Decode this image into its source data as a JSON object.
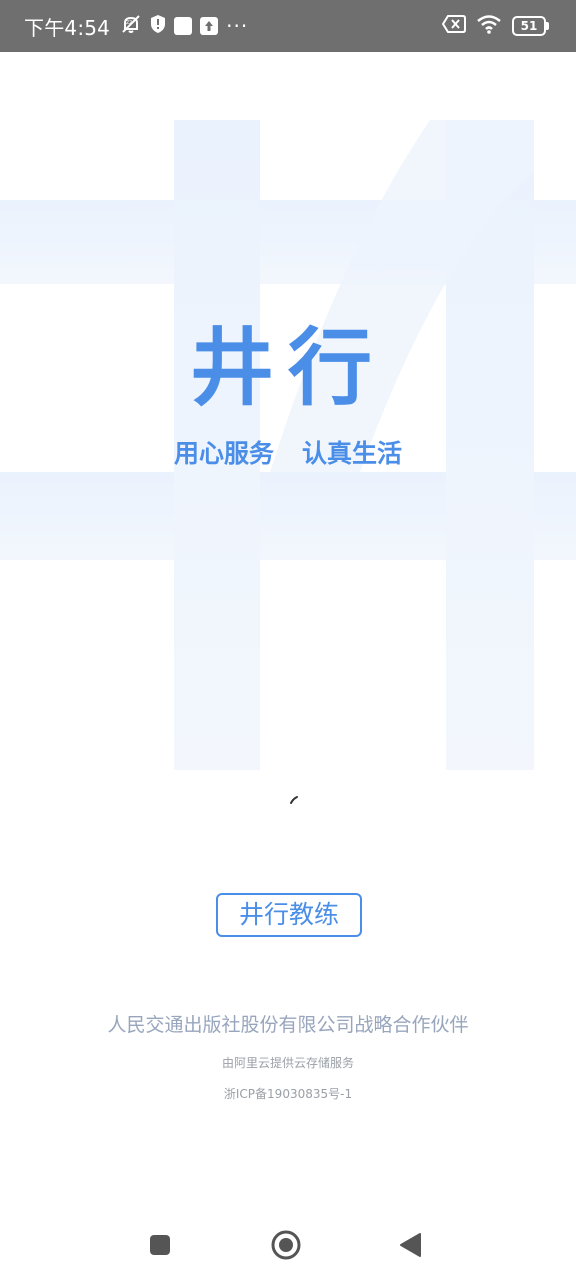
{
  "status_bar": {
    "time": "下午4:54",
    "battery_level": "51"
  },
  "logo": {
    "title": "井行"
  },
  "slogan": {
    "part1": "用心服务",
    "part2": "认真生活"
  },
  "coach_button": {
    "label": "井行教练"
  },
  "footer": {
    "partner": "人民交通出版社股份有限公司战略合作伙伴",
    "storage": "由阿里云提供云存储服务",
    "icp": "浙ICP备19030835号-1"
  },
  "icons": {
    "status_left": [
      "muted-bell-icon",
      "shield-icon",
      "square-notification-icon",
      "upload-icon",
      "more-icon"
    ],
    "status_right": [
      "sim-x-icon",
      "wifi-icon",
      "battery-icon"
    ],
    "nav": [
      "recent-apps-icon",
      "home-icon",
      "back-icon"
    ]
  },
  "colors": {
    "brand_blue": "#4b8ee8",
    "watermark": "#eef4fd",
    "status_bar": "#6f6f6f",
    "footer_text": "#98a6bd",
    "nav_icon": "#555555"
  }
}
